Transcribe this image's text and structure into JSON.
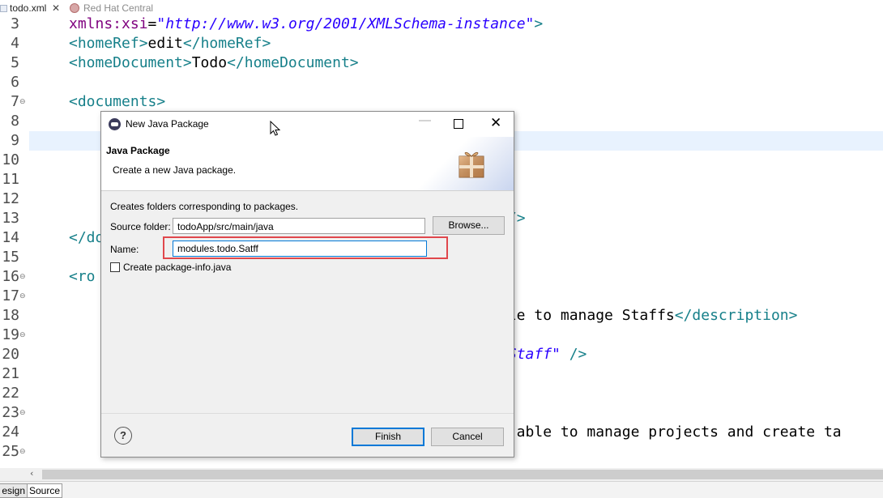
{
  "tabs": {
    "file_tab": "todo.xml",
    "close_glyph": "✕",
    "other_tab": "Red Hat Central"
  },
  "editor": {
    "lines": [
      {
        "n": "3",
        "fold": "",
        "html": "<span class=\"attrc\">xmlns:xsi</span>=<span class=\"strc\">\"http://www.w3.org/2001/XMLSchema-instance\"</span><span class=\"tagc\">&gt;</span>"
      },
      {
        "n": "4",
        "fold": "",
        "html": "<span class=\"tagc\">&lt;homeRef&gt;</span>edit<span class=\"tagc\">&lt;/homeRef&gt;</span>"
      },
      {
        "n": "5",
        "fold": "",
        "html": "<span class=\"tagc\">&lt;homeDocument&gt;</span>Todo<span class=\"tagc\">&lt;/homeDocument&gt;</span>"
      },
      {
        "n": "6",
        "fold": "",
        "html": ""
      },
      {
        "n": "7",
        "fold": "⊖",
        "html": "<span class=\"tagc\">&lt;documents&gt;</span>"
      },
      {
        "n": "8",
        "fold": "",
        "html": ""
      },
      {
        "n": "9",
        "fold": "",
        "html": ""
      },
      {
        "n": "10",
        "fold": "",
        "html": ""
      },
      {
        "n": "11",
        "fold": "",
        "html": ""
      },
      {
        "n": "12",
        "fold": "",
        "html": ""
      },
      {
        "n": "13",
        "fold": "",
        "html": "                                                  <span class=\"tagc\">/&gt;</span>"
      },
      {
        "n": "14",
        "fold": "",
        "html": "<span class=\"tagc\">&lt;/do</span>"
      },
      {
        "n": "15",
        "fold": "",
        "html": ""
      },
      {
        "n": "16",
        "fold": "⊖",
        "html": "<span class=\"tagc\">&lt;ro</span>"
      },
      {
        "n": "17",
        "fold": "⊖",
        "html": ""
      },
      {
        "n": "18",
        "fold": "",
        "html": "                                                 ble to manage Staffs<span class=\"tagc\">&lt;/description&gt;</span>"
      },
      {
        "n": "19",
        "fold": "⊖",
        "html": ""
      },
      {
        "n": "20",
        "fold": "",
        "html": "                                                 <span class=\"strc\">\"Staff\"</span> <span class=\"tagc\">/&gt;</span>"
      },
      {
        "n": "21",
        "fold": "",
        "html": ""
      },
      {
        "n": "22",
        "fold": "",
        "html": ""
      },
      {
        "n": "23",
        "fold": "⊖",
        "html": ""
      },
      {
        "n": "24",
        "fold": "",
        "html": "                                                 e able to manage projects and create ta"
      },
      {
        "n": "25",
        "fold": "⊖",
        "html": ""
      }
    ]
  },
  "bottom_tabs": {
    "design": "esign",
    "source": "Source"
  },
  "dialog": {
    "title": "New Java Package",
    "header_title": "Java Package",
    "header_desc": "Create a new Java package.",
    "body_text": "Creates folders corresponding to packages.",
    "source_folder_label": "Source folder:",
    "source_folder_value": "todoApp/src/main/java",
    "browse_label": "Browse...",
    "name_label": "Name:",
    "name_value": "modules.todo.Satff",
    "pkginfo_label": "Create package-info.java",
    "help_glyph": "?",
    "finish_label": "Finish",
    "cancel_label": "Cancel",
    "minimize_glyph": "—",
    "close_glyph": "✕"
  },
  "colors": {
    "accent": "#0078d7",
    "highlight_box": "#e0474c",
    "xml_tag": "#17808a",
    "xml_attr": "#7f007f",
    "xml_string": "#2a00ff"
  },
  "icons": {
    "window_icon": "eclipse-icon",
    "banner_icon": "package-icon",
    "help_icon": "help-icon"
  }
}
